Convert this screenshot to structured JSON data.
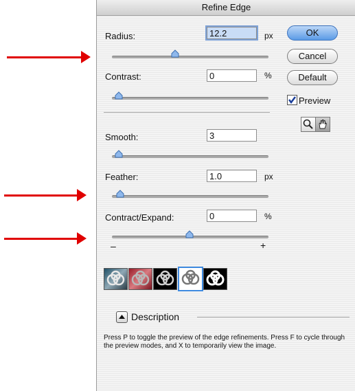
{
  "dialog": {
    "title": "Refine Edge",
    "radius": {
      "label": "Radius:",
      "value": "12.2",
      "unit": "px",
      "slider_level": 0.49
    },
    "contrast": {
      "label": "Contrast:",
      "value": "0",
      "unit": "%",
      "slider_level": 0.0
    },
    "smooth": {
      "label": "Smooth:",
      "value": "3",
      "slider_level": 0.03
    },
    "feather": {
      "label": "Feather:",
      "value": "1.0",
      "unit": "px",
      "slider_level": 0.04
    },
    "contract_expand": {
      "label": "Contract/Expand:",
      "value": "0",
      "unit": "%",
      "slider_level": 0.5,
      "min_label": "–",
      "max_label": "+"
    },
    "buttons": {
      "ok": "OK",
      "cancel": "Cancel",
      "default": "Default"
    },
    "preview": {
      "label": "Preview",
      "checked": true
    },
    "tools": [
      "zoom-icon",
      "hand-icon"
    ],
    "preview_modes": [
      "standard",
      "quick-mask",
      "on-black",
      "on-white",
      "mask"
    ],
    "selected_mode": 3,
    "description": {
      "label": "Description",
      "text": "Press P to toggle the preview of the edge refinements. Press F to cycle through the preview modes, and X to temporarily view the image."
    }
  },
  "annotations": {
    "arrow_color": "#e00000"
  }
}
